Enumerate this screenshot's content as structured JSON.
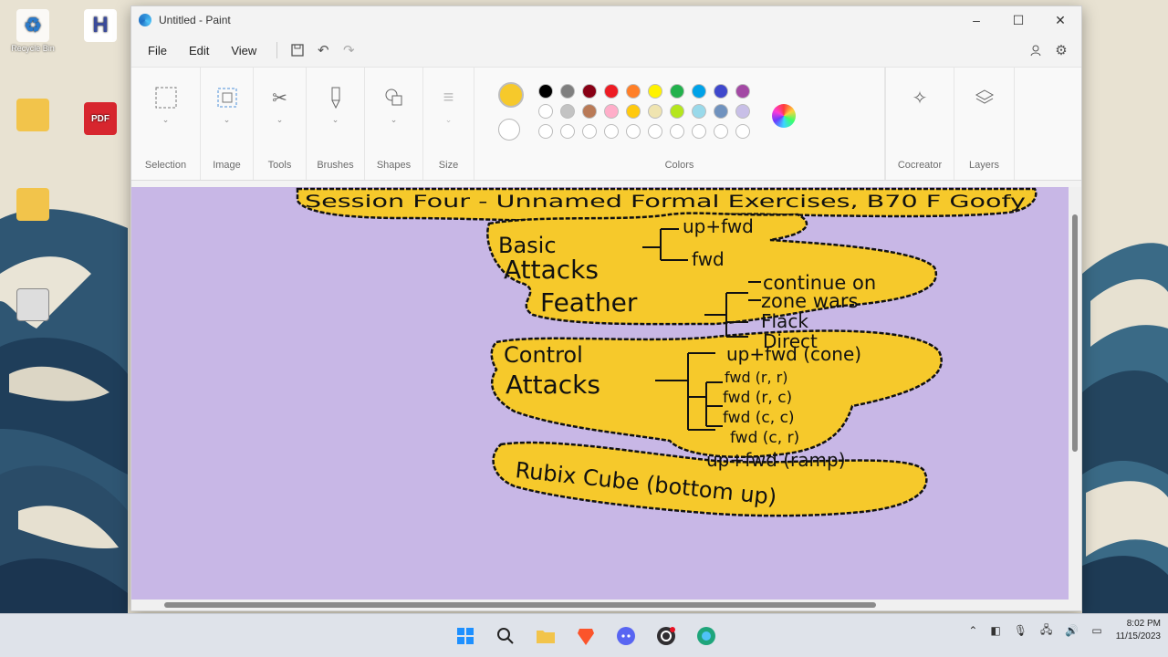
{
  "desktop": {
    "icons": [
      {
        "label": "Recycle Bin",
        "glyph": "♻"
      },
      {
        "label": "",
        "glyph": "H"
      },
      {
        "label": "",
        "glyph": ""
      },
      {
        "label": "",
        "glyph": "PDF"
      },
      {
        "label": "",
        "glyph": ""
      }
    ]
  },
  "window": {
    "title": "Untitled - Paint",
    "controls": {
      "minimize": "–",
      "maximize": "☐",
      "close": "✕"
    }
  },
  "menubar": {
    "file": "File",
    "edit": "Edit",
    "view": "View"
  },
  "ribbon": {
    "groups": [
      {
        "label": "Selection"
      },
      {
        "label": "Image"
      },
      {
        "label": "Tools"
      },
      {
        "label": "Brushes"
      },
      {
        "label": "Shapes"
      },
      {
        "label": "Size"
      }
    ],
    "colors_label": "Colors",
    "cocreator_label": "Cocreator",
    "layers_label": "Layers",
    "primary_color": "#f6c92b",
    "secondary_color": "#ffffff",
    "palette": [
      "#000000",
      "#7f7f7f",
      "#880015",
      "#ed1c24",
      "#ff7f27",
      "#fff200",
      "#22b14c",
      "#00a2e8",
      "#3f48cc",
      "#a349a4",
      "#ffffff",
      "#c3c3c3",
      "#b97a57",
      "#ffaec9",
      "#ffc90e",
      "#efe4b0",
      "#b5e61d",
      "#99d9ea",
      "#7092be",
      "#c8bfe7",
      "#ffffff",
      "#ffffff",
      "#ffffff",
      "#ffffff",
      "#ffffff",
      "#ffffff",
      "#ffffff",
      "#ffffff",
      "#ffffff",
      "#ffffff"
    ]
  },
  "canvas": {
    "background": "#c8b7e6",
    "blob_color": "#f6c92b",
    "title": "Session Four - Unnamed Formal Exercises, B70 F Goofy",
    "basic_attacks": {
      "label1": "Basic",
      "label2": "Attacks",
      "items": [
        "up+fwd",
        "fwd"
      ]
    },
    "feather": {
      "label": "Feather",
      "items": [
        "continue on",
        "zone wars",
        "Flack",
        "Direct"
      ]
    },
    "control_attacks": {
      "label1": "Control",
      "label2": "Attacks",
      "items": [
        "up+fwd (cone)",
        "fwd (r, r)",
        "fwd (r, c)",
        "fwd (c, c)",
        "fwd (c, r)",
        "up+fwd (ramp)"
      ]
    },
    "rubix": {
      "label": "Rubix Cube (bottom up)"
    }
  },
  "taskbar": {
    "apps": [
      "windows-start",
      "search",
      "file-explorer",
      "brave-browser",
      "discord",
      "obs",
      "edge"
    ],
    "time": "8:02 PM",
    "date": "11/15/2023"
  }
}
